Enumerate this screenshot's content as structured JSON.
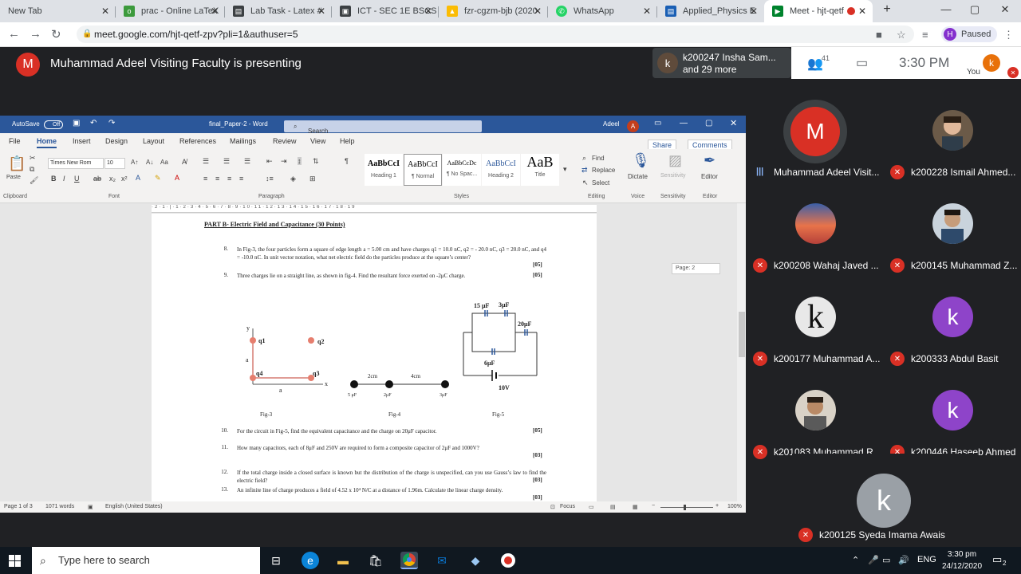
{
  "browser": {
    "tabs": [
      {
        "title": "New Tab",
        "icon": "newtab-icon"
      },
      {
        "title": "prac - Online LaTeX",
        "icon": "overleaf-icon"
      },
      {
        "title": "Lab Task - Latex #",
        "icon": "document-icon"
      },
      {
        "title": "ICT - SEC 1E BSCS",
        "icon": "classroom-icon"
      },
      {
        "title": "fzr-cgzm-bjb (2020",
        "icon": "drive-icon"
      },
      {
        "title": "WhatsApp",
        "icon": "whatsapp-icon"
      },
      {
        "title": "Applied_Physics E",
        "icon": "document-icon"
      },
      {
        "title": "Meet - hjt-qetf",
        "icon": "meet-icon"
      }
    ],
    "new_tab_symbol": "+",
    "url": "meet.google.com/hjt-qetf-zpv?pli=1&authuser=5",
    "profile": {
      "initial": "H",
      "status": "Paused"
    }
  },
  "meet": {
    "presenter_initial": "M",
    "presenting_text": "Muhammad Adeel Visiting Faculty is presenting",
    "join_notice": {
      "initial": "k",
      "line1": "k200247 Insha Sam...",
      "line2": "and 29 more"
    },
    "people_count": "41",
    "time": "3:30 PM",
    "you_initial": "k",
    "you_label": "You",
    "participants": [
      {
        "name": "Muhammad Adeel Visit...",
        "initial": "M",
        "color": "#d93025",
        "speaking": true
      },
      {
        "name": "k200228 Ismail Ahmed...",
        "initial": "",
        "color": "#6b5a48",
        "speaking": false
      },
      {
        "name": "k200208 Wahaj Javed ...",
        "initial": "",
        "color": "#c0504d",
        "speaking": false
      },
      {
        "name": "k200145 Muhammad Z...",
        "initial": "",
        "color": "#4a6a8a",
        "speaking": false
      },
      {
        "name": "k200177 Muhammad A...",
        "initial": "k",
        "color": "#3c4043",
        "speaking": false
      },
      {
        "name": "k200333 Abdul Basit",
        "initial": "k",
        "color": "#8e44c9",
        "speaking": false
      },
      {
        "name": "k201083 Muhammad R...",
        "initial": "",
        "color": "#7a6a5a",
        "speaking": false
      },
      {
        "name": "k200446 Haseeb Ahmed",
        "initial": "k",
        "color": "#8e44c9",
        "speaking": false
      }
    ],
    "last_participant": {
      "name": "k200125 Syeda Imama Awais",
      "initial": "k"
    }
  },
  "word": {
    "autosave_label": "AutoSave",
    "autosave_state": "Off",
    "doc_title": "final_Paper-2 - Word",
    "search_placeholder": "Search",
    "user_name": "Adeel",
    "user_initial": "A",
    "menu": [
      "File",
      "Home",
      "Insert",
      "Design",
      "Layout",
      "References",
      "Mailings",
      "Review",
      "View",
      "Help"
    ],
    "share_label": "Share",
    "comments_label": "Comments",
    "font_name": "Times New Rom",
    "font_size": "10",
    "paste_label": "Paste",
    "styles": [
      {
        "preview": "AaBbCcI",
        "name": "Heading 1"
      },
      {
        "preview": "AaBbCcI",
        "name": "¶ Normal"
      },
      {
        "preview": "AaBbCcDc",
        "name": "¶ No Spac..."
      },
      {
        "preview": "AaBbCcI",
        "name": "Heading 2"
      },
      {
        "preview": "AaB",
        "name": "Title"
      }
    ],
    "editing": {
      "find": "Find",
      "replace": "Replace",
      "select": "Select"
    },
    "tools": {
      "dictate": "Dictate",
      "sensitivity": "Sensitivity",
      "editor": "Editor"
    },
    "groups": [
      "Clipboard",
      "Font",
      "Paragraph",
      "Styles",
      "Editing",
      "Voice",
      "Sensitivity",
      "Editor"
    ],
    "page_indicator": "Page: 2",
    "status": {
      "page": "Page 1 of 3",
      "words": "1071 words",
      "language": "English (United States)",
      "focus": "Focus",
      "zoom": "100%"
    },
    "document": {
      "part_heading": "PART B- Electric Field and Capacitance (30 Points)",
      "questions": [
        {
          "num": "8.",
          "text": "In Fig-3, the four particles form a square of edge length a = 5.00 cm and have charges q1 = 10.0 nC, q2 = - 20.0 nC, q3 = 20.0 nC, and q4 = -10.0 nC. In unit vector notation, what net electric field do the particles produce at the square’s center?",
          "points": "[05]"
        },
        {
          "num": "9.",
          "text": "Three charges lie on a straight line, as shown in fig-4. Find the resultant force exerted on -2μC charge.",
          "points": "[05]"
        },
        {
          "num": "10.",
          "text": "For the circuit in Fig-5, find the equivalent capacitance and the charge on 20μF capacitor.",
          "points": "[05]"
        },
        {
          "num": "11.",
          "text": "How many capacitors, each of 8μF and 250V are required to form a composite capacitor of 2μF and 1000V?",
          "points": "[03]"
        },
        {
          "num": "12.",
          "text": "If the total charge inside a closed surface is known but the distribution of the charge is unspecified, can you use Gauss’s law to find the electric field?",
          "points": "[03]"
        },
        {
          "num": "13.",
          "text": "An infinite line of charge produces a field of 4.52 x 10⁴ N/C at a distance of 1.96m. Calculate the linear charge density.",
          "points": "[03]"
        }
      ],
      "fig3": {
        "caption": "Fig-3",
        "labels": [
          "y",
          "q1",
          "q2",
          "q4",
          "q3",
          "x",
          "a",
          "a"
        ]
      },
      "fig4": {
        "caption": "Fig-4",
        "labels": [
          "2cm",
          "4cm",
          "5 μF",
          "2μF",
          "3μF"
        ]
      },
      "fig5": {
        "caption": "Fig-5",
        "labels": [
          "15 μF",
          "3μF",
          "20μF",
          "6μF",
          "10V"
        ]
      }
    }
  },
  "taskbar": {
    "search_placeholder": "Type here to search",
    "language": "ENG",
    "time": "3:30 pm",
    "date": "24/12/2020",
    "notification_count": "2"
  },
  "colors": {
    "meet_bg": "#202124",
    "word_blue": "#2b579a",
    "mute_red": "#d93025"
  }
}
